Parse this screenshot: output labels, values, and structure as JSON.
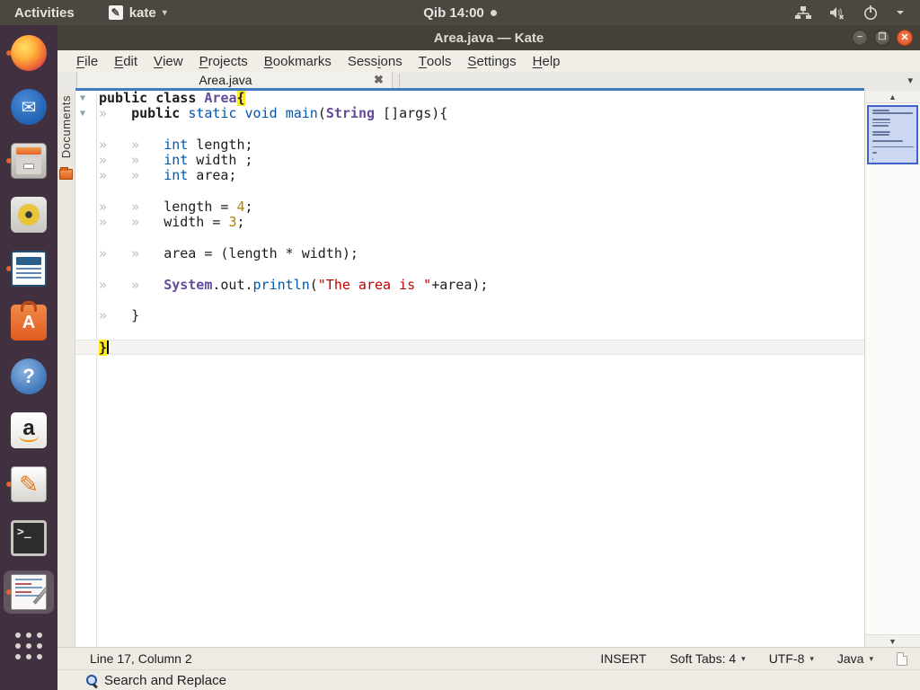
{
  "colors": {
    "accent_blue": "#3e7bbf",
    "close_orange": "#e0502a",
    "dock_bg": "#413040",
    "topbar_bg": "#4b4741",
    "syntax_keyword": "#1f1c1b",
    "syntax_type": "#0057ae",
    "syntax_class": "#644a9b",
    "syntax_number": "#b08000",
    "syntax_string": "#bf0303",
    "bracket_highlight_bg": "#fdea20"
  },
  "topbar": {
    "activities": "Activities",
    "app_name": "kate",
    "app_caret": "▾",
    "clock": "Qib 14:00",
    "kate_icon_glyph": "✎",
    "icons": [
      "network-wired-icon",
      "volume-muted-icon",
      "power-icon",
      "chevron-down-icon"
    ]
  },
  "dock": {
    "items": [
      {
        "name": "firefox",
        "running": true,
        "active": false
      },
      {
        "name": "thunderbird",
        "running": false,
        "active": false
      },
      {
        "name": "files",
        "running": true,
        "active": false
      },
      {
        "name": "rhythmbox",
        "running": false,
        "active": false
      },
      {
        "name": "libreoffice-writer",
        "running": true,
        "active": false
      },
      {
        "name": "ubuntu-software",
        "running": false,
        "active": false
      },
      {
        "name": "help",
        "running": false,
        "active": false
      },
      {
        "name": "amazon",
        "running": false,
        "active": false
      },
      {
        "name": "text-editor",
        "running": true,
        "active": false
      },
      {
        "name": "terminal",
        "running": false,
        "active": false
      },
      {
        "name": "kate",
        "running": true,
        "active": true
      },
      {
        "name": "show-applications",
        "running": false,
        "active": false
      }
    ],
    "glyphs": {
      "thunderbird": "✉",
      "ubuntu-software": "A",
      "help": "?",
      "amazon": "a",
      "text-editor": "✎",
      "terminal": ">_"
    }
  },
  "window": {
    "title": "Area.java — Kate",
    "buttons": {
      "minimize": "−",
      "maximize": "❐",
      "close": "✕"
    },
    "menubar": {
      "items": [
        {
          "label": "File",
          "accel": 0
        },
        {
          "label": "Edit",
          "accel": 0
        },
        {
          "label": "View",
          "accel": 0
        },
        {
          "label": "Projects",
          "accel": 0
        },
        {
          "label": "Bookmarks",
          "accel": 0
        },
        {
          "label": "Sessions",
          "accel": 4
        },
        {
          "label": "Tools",
          "accel": 0
        },
        {
          "label": "Settings",
          "accel": 0
        },
        {
          "label": "Help",
          "accel": 0
        }
      ]
    },
    "tabbar": {
      "tab_label": "Area.java",
      "close_glyph": "✖",
      "list_caret": "▾"
    },
    "sidebar": {
      "documents_label": "Documents"
    },
    "scrollbar": {
      "up_glyph": "▲",
      "down_glyph": "▼"
    },
    "statusbar": {
      "line_col": "Line 17, Column 2",
      "mode": "INSERT",
      "tab_mode": "Soft Tabs: 4",
      "encoding": "UTF-8",
      "language": "Java",
      "caret": "▾"
    },
    "search_button": "Search and Replace"
  },
  "editor": {
    "tab_marker": "»",
    "fold_marker": "▼",
    "lines": [
      {
        "fold": true,
        "segs": [
          [
            "k",
            "public class "
          ],
          [
            "c",
            "Area"
          ],
          [
            "b",
            "{"
          ]
        ]
      },
      {
        "fold": true,
        "segs": [
          [
            "T"
          ],
          [
            "k",
            "public"
          ],
          [
            "p",
            " "
          ],
          [
            "t",
            "static"
          ],
          [
            "p",
            " "
          ],
          [
            "t",
            "void"
          ],
          [
            "p",
            " "
          ],
          [
            "t",
            "main"
          ],
          [
            "p",
            "("
          ],
          [
            "c",
            "String"
          ],
          [
            "p",
            " []args){"
          ]
        ]
      },
      {
        "segs": []
      },
      {
        "segs": [
          [
            "T"
          ],
          [
            "T"
          ],
          [
            "t",
            "int"
          ],
          [
            "p",
            " length;"
          ]
        ]
      },
      {
        "segs": [
          [
            "T"
          ],
          [
            "T"
          ],
          [
            "t",
            "int"
          ],
          [
            "p",
            " width ;"
          ]
        ]
      },
      {
        "segs": [
          [
            "T"
          ],
          [
            "T"
          ],
          [
            "t",
            "int"
          ],
          [
            "p",
            " area;"
          ]
        ]
      },
      {
        "segs": []
      },
      {
        "segs": [
          [
            "T"
          ],
          [
            "T"
          ],
          [
            "p",
            "length = "
          ],
          [
            "n",
            "4"
          ],
          [
            "p",
            ";"
          ]
        ]
      },
      {
        "segs": [
          [
            "T"
          ],
          [
            "T"
          ],
          [
            "p",
            "width = "
          ],
          [
            "n",
            "3"
          ],
          [
            "p",
            ";"
          ]
        ]
      },
      {
        "segs": []
      },
      {
        "segs": [
          [
            "T"
          ],
          [
            "T"
          ],
          [
            "p",
            "area = (length * width);"
          ]
        ]
      },
      {
        "segs": []
      },
      {
        "segs": [
          [
            "T"
          ],
          [
            "T"
          ],
          [
            "c",
            "System"
          ],
          [
            "p",
            ".out."
          ],
          [
            "t",
            "println"
          ],
          [
            "p",
            "("
          ],
          [
            "s",
            "\"The area is \""
          ],
          [
            "p",
            "+area);"
          ]
        ]
      },
      {
        "segs": []
      },
      {
        "segs": [
          [
            "T"
          ],
          [
            "p",
            "}"
          ]
        ]
      },
      {
        "segs": []
      },
      {
        "current": true,
        "segs": [
          [
            "b",
            "}"
          ],
          [
            "CUR"
          ]
        ]
      }
    ]
  }
}
